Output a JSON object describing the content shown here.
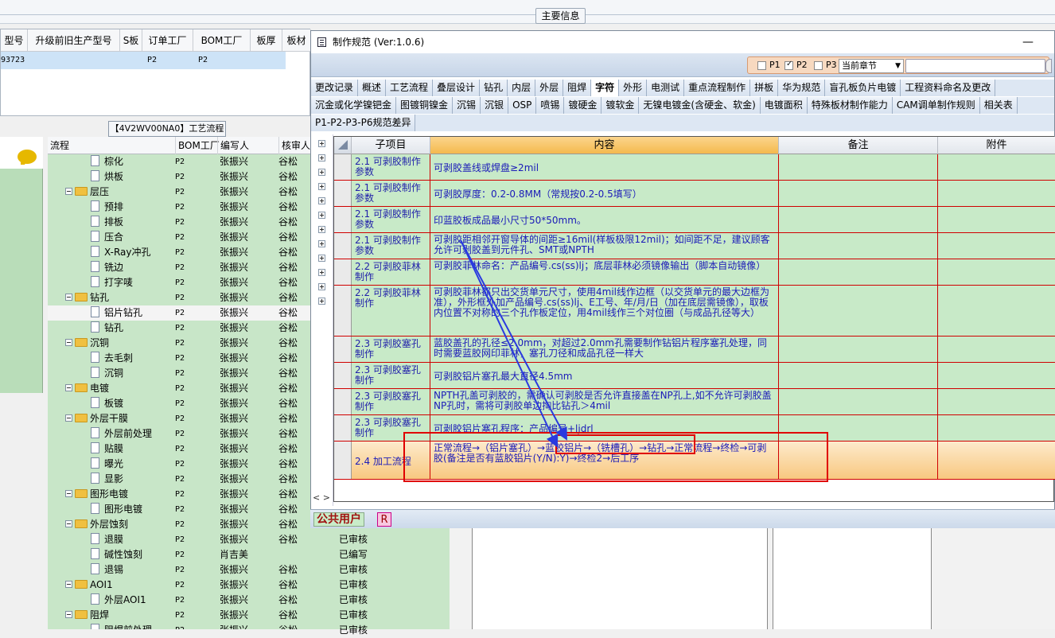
{
  "background_app": {
    "section_title": "主要信息",
    "top_grid": {
      "headers": [
        "型号",
        "升级前旧生产型号",
        "S板",
        "订单工厂",
        "BOM工厂",
        "板厚",
        "板材"
      ],
      "selected_row": {
        "model": "93723",
        "order_factory": "P2",
        "bom_factory": "P2"
      }
    },
    "flow_panel_title": "【4V2WV00NA0】工艺流程",
    "tree_headers": [
      "流程",
      "BOM工厂",
      "编写人",
      "核审人"
    ],
    "tree_rows": [
      {
        "level": 2,
        "kind": "doc",
        "name": "棕化",
        "factory": "P2",
        "writer": "张振兴",
        "reviewer": "谷松"
      },
      {
        "level": 2,
        "kind": "doc",
        "name": "烘板",
        "factory": "P2",
        "writer": "张振兴",
        "reviewer": "谷松"
      },
      {
        "level": 1,
        "kind": "folder",
        "name": "层压",
        "factory": "P2",
        "writer": "张振兴",
        "reviewer": "谷松"
      },
      {
        "level": 2,
        "kind": "doc",
        "name": "预排",
        "factory": "P2",
        "writer": "张振兴",
        "reviewer": "谷松"
      },
      {
        "level": 2,
        "kind": "doc",
        "name": "排板",
        "factory": "P2",
        "writer": "张振兴",
        "reviewer": "谷松"
      },
      {
        "level": 2,
        "kind": "doc",
        "name": "压合",
        "factory": "P2",
        "writer": "张振兴",
        "reviewer": "谷松"
      },
      {
        "level": 2,
        "kind": "doc",
        "name": "X-Ray冲孔",
        "factory": "P2",
        "writer": "张振兴",
        "reviewer": "谷松"
      },
      {
        "level": 2,
        "kind": "doc",
        "name": "铣边",
        "factory": "P2",
        "writer": "张振兴",
        "reviewer": "谷松"
      },
      {
        "level": 2,
        "kind": "doc",
        "name": "打字唛",
        "factory": "P2",
        "writer": "张振兴",
        "reviewer": "谷松"
      },
      {
        "level": 1,
        "kind": "folder",
        "name": "钻孔",
        "factory": "P2",
        "writer": "张振兴",
        "reviewer": "谷松"
      },
      {
        "level": 2,
        "kind": "doc",
        "name": "铝片钻孔",
        "factory": "P2",
        "writer": "张振兴",
        "reviewer": "谷松",
        "selected": true
      },
      {
        "level": 2,
        "kind": "doc",
        "name": "钻孔",
        "factory": "P2",
        "writer": "张振兴",
        "reviewer": "谷松"
      },
      {
        "level": 1,
        "kind": "folder",
        "name": "沉铜",
        "factory": "P2",
        "writer": "张振兴",
        "reviewer": "谷松"
      },
      {
        "level": 2,
        "kind": "doc",
        "name": "去毛刺",
        "factory": "P2",
        "writer": "张振兴",
        "reviewer": "谷松"
      },
      {
        "level": 2,
        "kind": "doc",
        "name": "沉铜",
        "factory": "P2",
        "writer": "张振兴",
        "reviewer": "谷松"
      },
      {
        "level": 1,
        "kind": "folder",
        "name": "电镀",
        "factory": "P2",
        "writer": "张振兴",
        "reviewer": "谷松"
      },
      {
        "level": 2,
        "kind": "doc",
        "name": "板镀",
        "factory": "P2",
        "writer": "张振兴",
        "reviewer": "谷松"
      },
      {
        "level": 1,
        "kind": "folder",
        "name": "外层干膜",
        "factory": "P2",
        "writer": "张振兴",
        "reviewer": "谷松"
      },
      {
        "level": 2,
        "kind": "doc",
        "name": "外层前处理",
        "factory": "P2",
        "writer": "张振兴",
        "reviewer": "谷松"
      },
      {
        "level": 2,
        "kind": "doc",
        "name": "贴膜",
        "factory": "P2",
        "writer": "张振兴",
        "reviewer": "谷松"
      },
      {
        "level": 2,
        "kind": "doc",
        "name": "曝光",
        "factory": "P2",
        "writer": "张振兴",
        "reviewer": "谷松"
      },
      {
        "level": 2,
        "kind": "doc",
        "name": "显影",
        "factory": "P2",
        "writer": "张振兴",
        "reviewer": "谷松"
      },
      {
        "level": 1,
        "kind": "folder",
        "name": "图形电镀",
        "factory": "P2",
        "writer": "张振兴",
        "reviewer": "谷松"
      },
      {
        "level": 2,
        "kind": "doc",
        "name": "图形电镀",
        "factory": "P2",
        "writer": "张振兴",
        "reviewer": "谷松"
      },
      {
        "level": 1,
        "kind": "folder",
        "name": "外层蚀刻",
        "factory": "P2",
        "writer": "张振兴",
        "reviewer": "谷松"
      },
      {
        "level": 2,
        "kind": "doc",
        "name": "退膜",
        "factory": "P2",
        "writer": "张振兴",
        "reviewer": "谷松",
        "status": "已审核"
      },
      {
        "level": 2,
        "kind": "doc",
        "name": "碱性蚀刻",
        "factory": "P2",
        "writer": "肖吉美",
        "reviewer": "",
        "status": "已编写"
      },
      {
        "level": 2,
        "kind": "doc",
        "name": "退锡",
        "factory": "P2",
        "writer": "张振兴",
        "reviewer": "谷松",
        "status": "已审核"
      },
      {
        "level": 1,
        "kind": "folder",
        "name": "AOI1",
        "factory": "P2",
        "writer": "张振兴",
        "reviewer": "谷松",
        "status": "已审核"
      },
      {
        "level": 2,
        "kind": "doc",
        "name": "外层AOI1",
        "factory": "P2",
        "writer": "张振兴",
        "reviewer": "谷松",
        "status": "已审核"
      },
      {
        "level": 1,
        "kind": "folder",
        "name": "阻焊",
        "factory": "P2",
        "writer": "张振兴",
        "reviewer": "谷松",
        "status": "已审核"
      },
      {
        "level": 2,
        "kind": "doc",
        "name": "阻焊前处理",
        "factory": "P2",
        "writer": "张振兴",
        "reviewer": "谷松",
        "status": "已审核"
      }
    ]
  },
  "dialog": {
    "title": "制作规范 (Ver:1.0.6)",
    "minimize": "—",
    "filter": {
      "p1": "P1",
      "p2": "P2",
      "p3": "P3",
      "p1_checked": false,
      "p2_checked": true,
      "p3_checked": false,
      "chapter": "当前章节",
      "search": ""
    },
    "tabs_row1": [
      "更改记录",
      "概述",
      "工艺流程",
      "叠层设计",
      "钻孔",
      "内层",
      "外层",
      "阻焊",
      "字符",
      "外形",
      "电测试",
      "重点流程制作",
      "拼板",
      "华为规范",
      "盲孔板负片电镀",
      "工程资料命名及更改"
    ],
    "active_tab": "字符",
    "tabs_row2": [
      "沉金或化学镍钯金",
      "图镀铜镍金",
      "沉锡",
      "沉银",
      "OSP",
      "喷锡",
      "镀硬金",
      "镀软金",
      "无镍电镀金(含硬金、软金)",
      "电镀面积",
      "特殊板材制作能力",
      "CAM调单制作规则",
      "相关表"
    ],
    "tabs_row3": [
      "P1-P2-P3-P6规范差异"
    ],
    "grid": {
      "headers": [
        "子项目",
        "内容",
        "备注",
        "附件"
      ],
      "rows": [
        {
          "sub": "2.1 可剥胶制作参数",
          "content": "可剥胶盖线或焊盘≥2mil"
        },
        {
          "sub": "2.1 可剥胶制作参数",
          "content": "可剥胶厚度：0.2-0.8MM（常规按0.2-0.5填写）"
        },
        {
          "sub": "2.1 可剥胶制作参数",
          "content": "印蓝胶板成品最小尺寸50*50mm。"
        },
        {
          "sub": "2.1 可剥胶制作参数",
          "content": "可剥胶距相邻开窗导体的间距≥16mil(样板极限12mil)；如间距不足，建议顾客允许可剥胶盖到元件孔、SMT或NPTH"
        },
        {
          "sub": "2.2 可剥胶菲林制作",
          "content": "可剥胶菲林命名：产品编号.cs(ss)lj；底层菲林必须镜像输出（脚本自动镜像）"
        },
        {
          "sub": "2.2 可剥胶菲林制作",
          "content": "可剥胶菲林都只出交货单元尺寸，使用4mil线作边框（以交货单元的最大边框为准），外形框外加产品编号.cs(ss)lj、E工号、年/月/日（加在底层需镜像），取板内位置不对称的三个孔作板定位，用4mil线作三个对位圈（与成品孔径等大）"
        },
        {
          "sub": "2.3 可剥胶塞孔制作",
          "content": "蓝胶盖孔的孔径≤2.0mm，对超过2.0mm孔需要制作钻铝片程序塞孔处理，同时需要蓝胶网印菲林，塞孔刀径和成品孔径一样大"
        },
        {
          "sub": "2.3 可剥胶塞孔制作",
          "content": "可剥胶铝片塞孔最大直径4.5mm"
        },
        {
          "sub": "2.3 可剥胶塞孔制作",
          "content": "NPTH孔盖可剥胶的，需确认可剥胶是否允许直接盖在NP孔上,如不允许可剥胶盖NP孔时，需将可剥胶单边掏比钻孔＞4mil"
        },
        {
          "sub": "2.3 可剥胶塞孔制作",
          "content": "可剥胶铝片塞孔程序：产品编号+ljdrl"
        },
        {
          "sub": "2.4 加工流程",
          "content": "正常流程→（铝片塞孔）→蓝胶铝片→（铣槽孔）→钻孔→正常流程→终检→可剥胶(备注是否有蓝胶铝片(Y/N):Y)→终检2→后工序",
          "current": true
        }
      ]
    },
    "scroll_hint": "< >"
  },
  "user_bar": {
    "public_user": "公共用户",
    "r_label": "R"
  },
  "colors": {
    "grid_green": "#c8eac8",
    "grid_red_line": "#d00000",
    "header_orange": "#f4b94e",
    "annotation_red": "#e00000",
    "arrow_blue": "#2a3adf"
  }
}
